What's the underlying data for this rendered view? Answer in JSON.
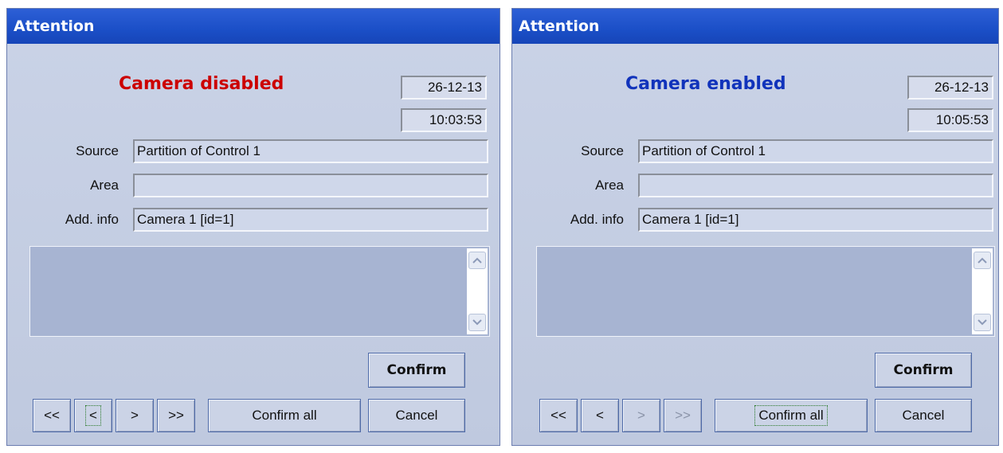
{
  "dialogs": [
    {
      "title": "Attention",
      "status": "Camera disabled",
      "status_color": "#cc0000",
      "date": "26-12-13",
      "time": "10:03:53",
      "fields": {
        "source_label": "Source",
        "source_value": "Partition of Control 1",
        "area_label": "Area",
        "area_value": "",
        "info_label": "Add. info",
        "info_value": "Camera 1 [id=1]"
      },
      "buttons": {
        "first": "<<",
        "prev": "<",
        "next": ">",
        "last": ">>",
        "confirm_all": "Confirm all",
        "confirm": "Confirm",
        "cancel": "Cancel"
      }
    },
    {
      "title": "Attention",
      "status": "Camera enabled",
      "status_color": "#1133bb",
      "date": "26-12-13",
      "time": "10:05:53",
      "fields": {
        "source_label": "Source",
        "source_value": "Partition of Control 1",
        "area_label": "Area",
        "area_value": "",
        "info_label": "Add. info",
        "info_value": "Camera 1 [id=1]"
      },
      "buttons": {
        "first": "<<",
        "prev": "<",
        "next": ">",
        "last": ">>",
        "confirm_all": "Confirm all",
        "confirm": "Confirm",
        "cancel": "Cancel"
      }
    }
  ],
  "icons": {
    "scroll_up": "chevron-up-icon",
    "scroll_down": "chevron-down-icon"
  }
}
